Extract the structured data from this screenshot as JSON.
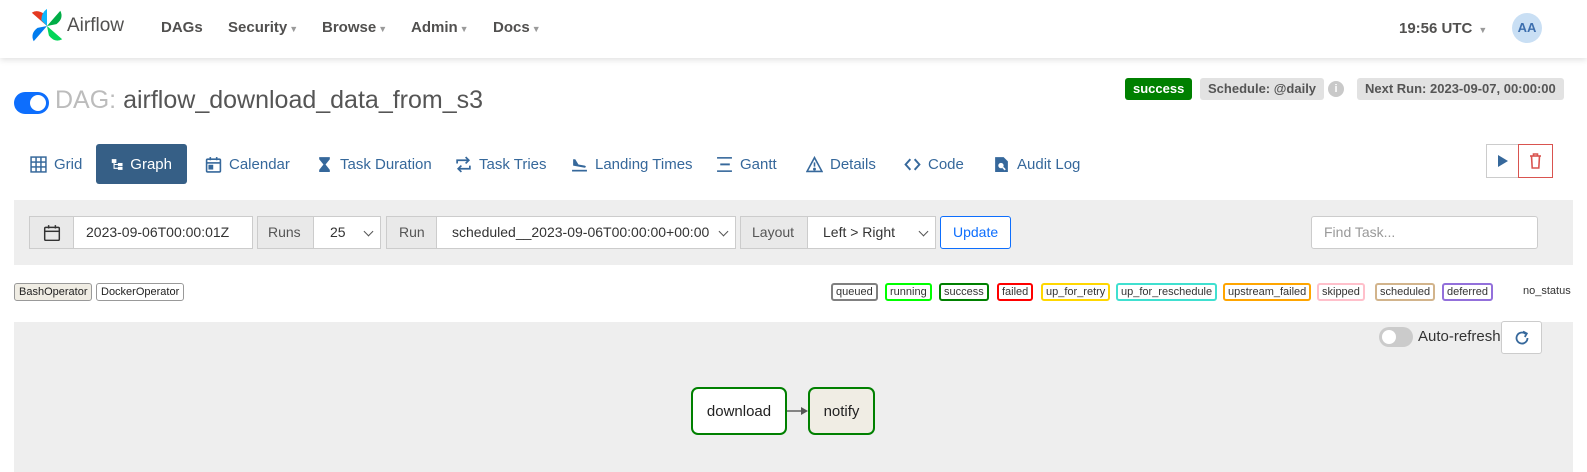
{
  "nav": {
    "brand": "Airflow",
    "items": [
      {
        "label": "DAGs",
        "has_caret": false
      },
      {
        "label": "Security",
        "has_caret": true
      },
      {
        "label": "Browse",
        "has_caret": true
      },
      {
        "label": "Admin",
        "has_caret": true
      },
      {
        "label": "Docs",
        "has_caret": true
      }
    ],
    "time": "19:56 UTC",
    "avatar_initials": "AA"
  },
  "dag": {
    "prefix": "DAG:",
    "id": "airflow_download_data_from_s3",
    "paused": false,
    "status": "success",
    "schedule": "Schedule: @daily",
    "next_run": "Next Run: 2023-09-07, 00:00:00"
  },
  "tabs": [
    {
      "label": "Grid",
      "icon": "grid-icon",
      "active": false
    },
    {
      "label": "Graph",
      "icon": "graph-icon",
      "active": true
    },
    {
      "label": "Calendar",
      "icon": "calendar-icon",
      "active": false
    },
    {
      "label": "Task Duration",
      "icon": "hourglass-icon",
      "active": false
    },
    {
      "label": "Task Tries",
      "icon": "retry-arrows-icon",
      "active": false
    },
    {
      "label": "Landing Times",
      "icon": "plane-landing-icon",
      "active": false
    },
    {
      "label": "Gantt",
      "icon": "gantt-icon",
      "active": false
    },
    {
      "label": "Details",
      "icon": "warning-triangle-icon",
      "active": false
    },
    {
      "label": "Code",
      "icon": "code-icon",
      "active": false
    },
    {
      "label": "Audit Log",
      "icon": "file-search-icon",
      "active": false
    }
  ],
  "actions": {
    "trigger": "play-icon",
    "delete": "trash-icon"
  },
  "filters": {
    "base_date": "2023-09-06T00:00:01Z",
    "runs_label": "Runs",
    "runs_value": "25",
    "run_label": "Run",
    "run_value": "scheduled__2023-09-06T00:00:00+00:00",
    "layout_label": "Layout",
    "layout_value": "Left > Right",
    "update_label": "Update",
    "find_placeholder": "Find Task..."
  },
  "operators": [
    {
      "label": "BashOperator",
      "color": "#f0ede4"
    },
    {
      "label": "DockerOperator",
      "color": "#ffffff"
    }
  ],
  "legend": [
    {
      "label": "queued",
      "color": "#808080"
    },
    {
      "label": "running",
      "color": "#00ff00"
    },
    {
      "label": "success",
      "color": "#008000"
    },
    {
      "label": "failed",
      "color": "#ff0000"
    },
    {
      "label": "up_for_retry",
      "color": "#ffd700"
    },
    {
      "label": "up_for_reschedule",
      "color": "#40e0d0"
    },
    {
      "label": "upstream_failed",
      "color": "#ffa500"
    },
    {
      "label": "skipped",
      "color": "#ffc0cb"
    },
    {
      "label": "scheduled",
      "color": "#d2b48c"
    },
    {
      "label": "deferred",
      "color": "#9370db"
    }
  ],
  "legend_no_status": "no_status",
  "graph": {
    "auto_refresh_label": "Auto-refresh",
    "auto_refresh_on": false,
    "tasks": [
      {
        "id": "download",
        "state_color": "#008000",
        "fill": "#ffffff"
      },
      {
        "id": "notify",
        "state_color": "#008000",
        "fill": "#f0ede4"
      }
    ]
  }
}
